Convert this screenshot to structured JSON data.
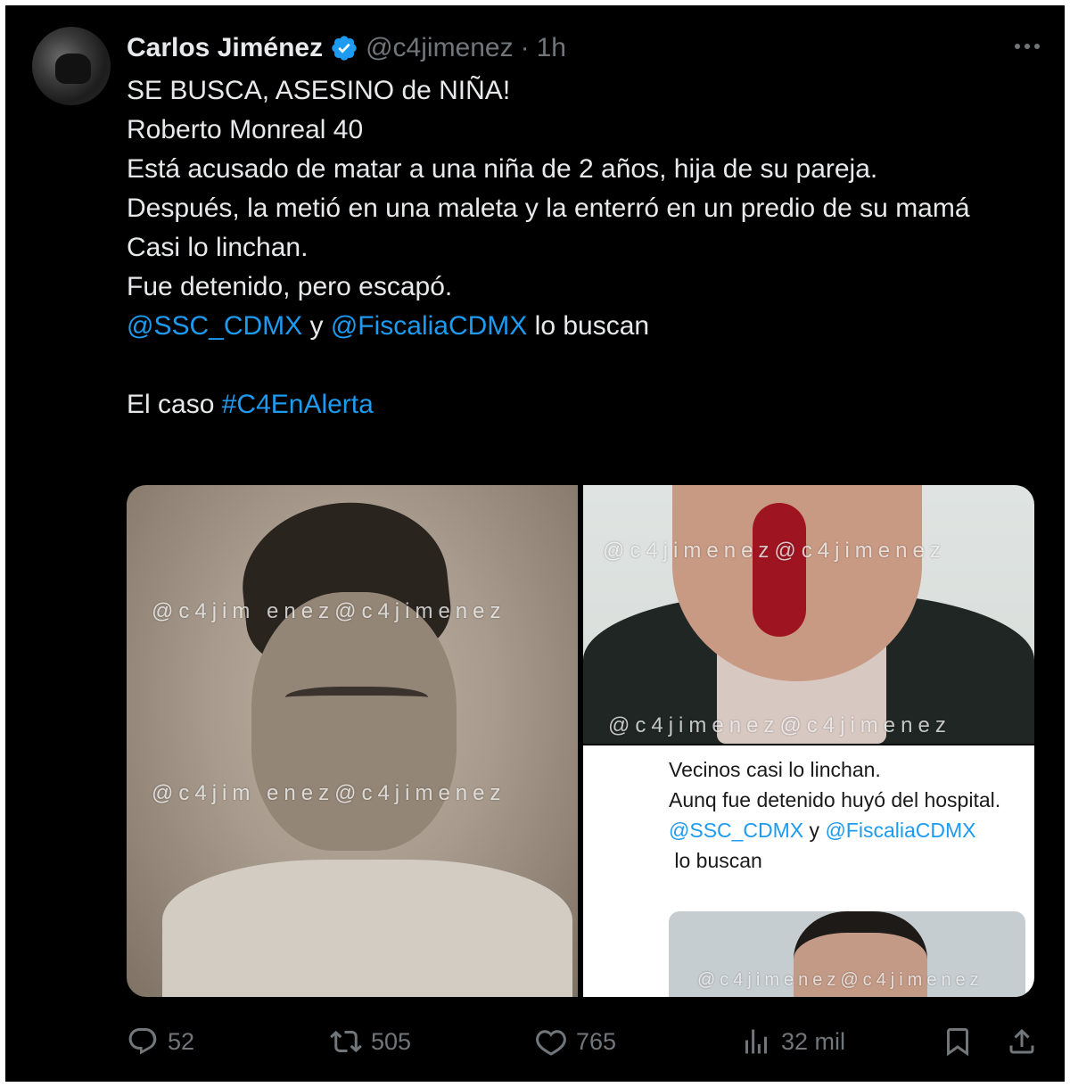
{
  "tweet": {
    "author_name": "Carlos Jiménez",
    "handle": "@c4jimenez",
    "separator": "·",
    "time": "1h",
    "lines": [
      "SE BUSCA, ASESINO de NIÑA!",
      "Roberto Monreal 40",
      "Está acusado de matar a una niña de 2 años, hija de su pareja.",
      "Después, la metió en una maleta y la enterró en un predio de su mamá",
      "Casi lo linchan.",
      "Fue detenido, pero escapó."
    ],
    "mention_1": "@SSC_CDMX",
    "connector": " y ",
    "mention_2": "@FiscaliaCDMX",
    "mention_suffix": " lo buscan",
    "case_prefix": "El caso ",
    "hashtag": "#C4EnAlerta"
  },
  "media": {
    "watermark_left_1": "@c4jim enez@c4jimenez",
    "watermark_left_2": "@c4jim enez@c4jimenez",
    "watermark_tr_1": "@c4jimenez@c4jimenez",
    "watermark_tr_2": "@c4jimenez@c4jimenez",
    "watermark_br": "@c4jimenez@c4jimenez",
    "embedded": {
      "line_1": "Vecinos casi lo linchan.",
      "line_2": "Aunq fue detenido huyó del hospital.",
      "mention_1": "@SSC_CDMX",
      "connector": " y ",
      "mention_2": "@FiscaliaCDMX",
      "suffix": " lo buscan"
    }
  },
  "actions": {
    "replies": "52",
    "reposts": "505",
    "likes": "765",
    "views": "32 mil"
  },
  "colors": {
    "background": "#000000",
    "text": "#e7e9ea",
    "muted": "#71767b",
    "link": "#1d9bf0",
    "verified": "#1d9bf0"
  }
}
